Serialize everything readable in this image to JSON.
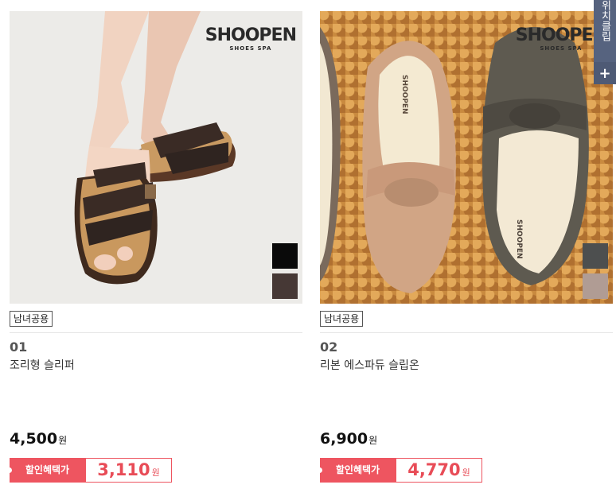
{
  "products": [
    {
      "tag": "남녀공용",
      "number": "01",
      "name": "조리형 슬리퍼",
      "price": "4,500",
      "currency": "원",
      "discount_label": "할인혜택가",
      "discount_price": "3,110",
      "brand": {
        "name": "SHOOPEN",
        "sub": "SHOES SPA"
      },
      "swatches": [
        "#0a0a0a",
        "#463835"
      ]
    },
    {
      "tag": "남녀공용",
      "number": "02",
      "name": "리본 에스파듀 슬립온",
      "price": "6,900",
      "currency": "원",
      "discount_label": "할인혜택가",
      "discount_price": "4,770",
      "brand": {
        "name": "SHOOPEN",
        "sub": "SHOES SPA"
      },
      "swatches": [
        "#4d4f4f",
        "#b09c94"
      ]
    }
  ],
  "side_panel": {
    "label": "위치클립",
    "plus": "+"
  },
  "colors": {
    "accent": "#ee5560",
    "panel": "#4e5a75"
  }
}
